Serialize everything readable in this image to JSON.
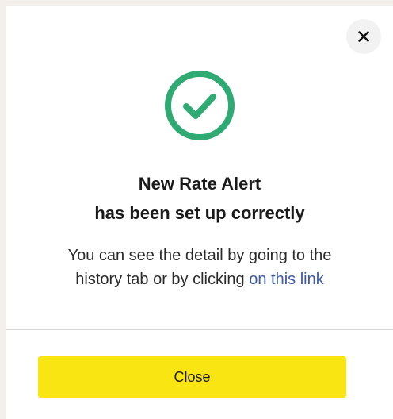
{
  "dialog": {
    "title_line1": "New Rate Alert",
    "title_line2": "has been set up correctly",
    "message_line1": "You can see the detail by going to the",
    "message_line2_prefix": "history tab or by clicking ",
    "link_text": "on this link",
    "close_button_label": "Close",
    "icons": {
      "dismiss": "close-x-icon",
      "status": "check-circle-icon"
    },
    "colors": {
      "success": "#2faa72",
      "button": "#f8e511",
      "link": "#3c5aa8"
    }
  }
}
